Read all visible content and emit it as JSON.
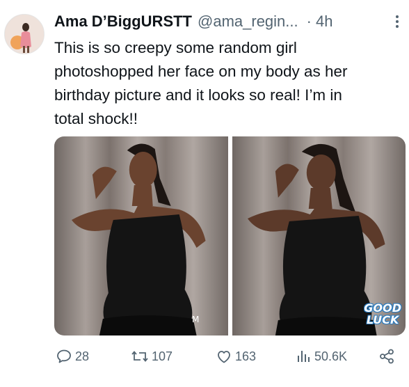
{
  "author": {
    "display_name": "Ama D’BiggURSTT",
    "handle": "@ama_regin...",
    "separator": "·",
    "time": "4h"
  },
  "tweet": {
    "text": "This is so creepy some random girl\nphotoshopped her face on my body as her\nbirthday picture and it looks so real! I’m in\ntotal shock!!"
  },
  "media": {
    "left_watermark": "M",
    "right_watermark_line1": "GOOD",
    "right_watermark_line2": "LUCK"
  },
  "actions": {
    "replies": "28",
    "reposts": "107",
    "likes": "163",
    "views": "50.6K"
  },
  "colors": {
    "text": "#0f1419",
    "secondary": "#536471",
    "background": "#ffffff"
  },
  "icons": [
    "more-icon",
    "reply-icon",
    "repost-icon",
    "like-icon",
    "views-icon",
    "share-icon"
  ]
}
